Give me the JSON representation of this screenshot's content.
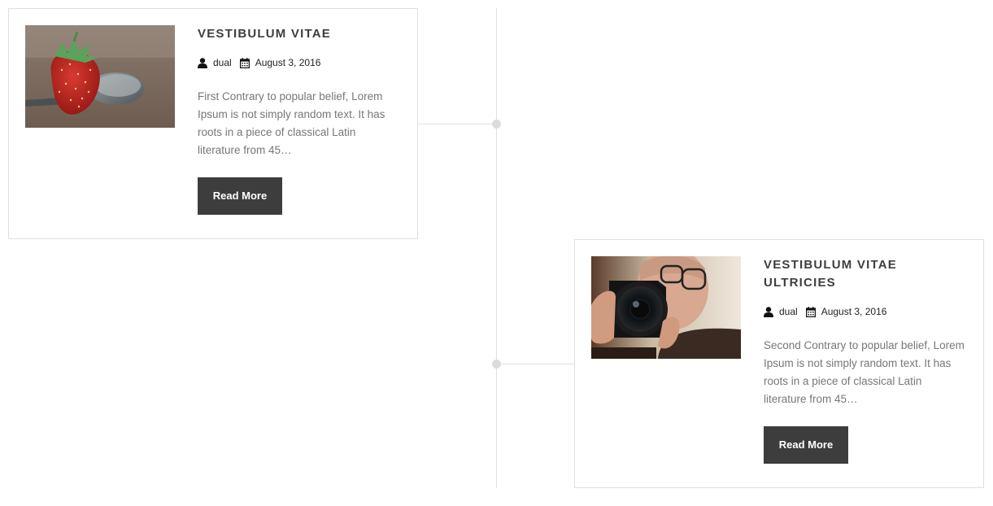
{
  "posts": [
    {
      "title": "VESTIBULUM VITAE",
      "author": "dual",
      "date": "August 3, 2016",
      "excerpt": "First Contrary to popular belief, Lorem Ipsum is not simply random text. It has roots in a piece of classical Latin literature from 45…",
      "button_label": "Read More",
      "image": "strawberry-in-spoon-photo"
    },
    {
      "title": "VESTIBULUM VITAE ULTRICIES",
      "author": "dual",
      "date": "August 3, 2016",
      "excerpt": "Second Contrary to popular belief, Lorem Ipsum is not simply random text. It has roots in a piece of classical Latin literature from 45…",
      "button_label": "Read More",
      "image": "photographer-with-camera-photo"
    }
  ],
  "icons": {
    "author": "user-icon",
    "date": "calendar-icon"
  },
  "colors": {
    "button_bg": "#3d3d3d",
    "title": "#3e3e3e",
    "timeline": "#e2e2e2"
  }
}
